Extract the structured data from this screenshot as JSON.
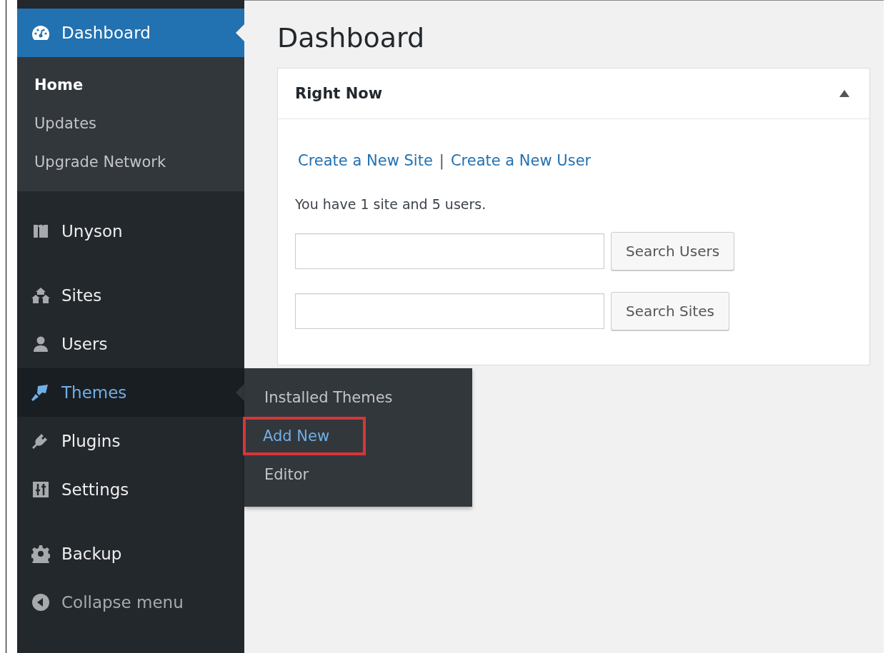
{
  "sidebar": {
    "groups": [
      [
        {
          "label": "Dashboard",
          "kind": "dashboard",
          "selected": true,
          "hovered": false,
          "children": [
            {
              "label": "Home",
              "selected": true
            },
            {
              "label": "Updates",
              "selected": false
            },
            {
              "label": "Upgrade Network",
              "selected": false
            }
          ]
        }
      ],
      [
        {
          "label": "Unyson",
          "kind": "unyson",
          "selected": false,
          "hovered": false
        }
      ],
      [
        {
          "label": "Sites",
          "kind": "sites",
          "selected": false,
          "hovered": false
        },
        {
          "label": "Users",
          "kind": "users",
          "selected": false,
          "hovered": false
        },
        {
          "label": "Themes",
          "kind": "themes",
          "selected": false,
          "hovered": true,
          "flyout": [
            {
              "label": "Installed Themes",
              "highlighted": false
            },
            {
              "label": "Add New",
              "highlighted": true
            },
            {
              "label": "Editor",
              "highlighted": false
            }
          ]
        },
        {
          "label": "Plugins",
          "kind": "plugins",
          "selected": false,
          "hovered": false
        },
        {
          "label": "Settings",
          "kind": "settings",
          "selected": false,
          "hovered": false
        }
      ],
      [
        {
          "label": "Backup",
          "kind": "backup",
          "selected": false,
          "hovered": false
        },
        {
          "label": "Collapse menu",
          "kind": "collapse",
          "selected": false,
          "hovered": false
        }
      ]
    ]
  },
  "main": {
    "title": "Dashboard",
    "widget": {
      "title": "Right Now",
      "expanded": true,
      "links": [
        "Create a New Site",
        "Create a New User"
      ],
      "link_separator": "|",
      "summary": "You have 1 site and 5 users.",
      "searches": [
        {
          "button": "Search Users"
        },
        {
          "button": "Search Sites"
        }
      ]
    }
  }
}
